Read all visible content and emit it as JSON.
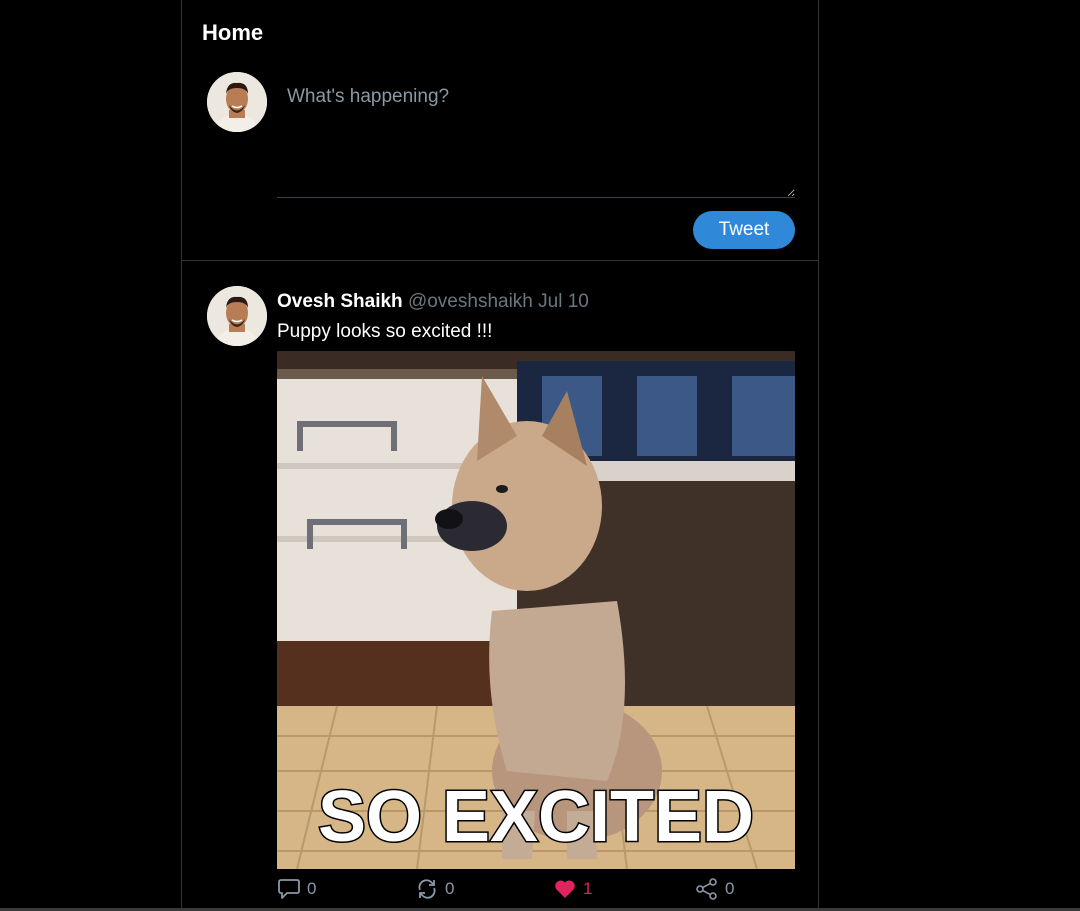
{
  "header": {
    "title": "Home"
  },
  "composer": {
    "placeholder": "What's happening?",
    "value": "",
    "tweet_label": "Tweet",
    "avatar_icon": "user-avatar"
  },
  "post": {
    "author_name": "Ovesh Shaikh",
    "author_handle": "@oveshshaikh",
    "date": "Jul 10",
    "text": "Puppy looks so excited !!!",
    "media_caption": "SO EXCITED",
    "avatar_icon": "user-avatar",
    "actions": {
      "reply": {
        "icon": "comment-icon",
        "count": "0"
      },
      "retweet": {
        "icon": "retweet-icon",
        "count": "0"
      },
      "like": {
        "icon": "heart-icon",
        "count": "1",
        "liked": true,
        "color": "#e0245e"
      },
      "share": {
        "icon": "share-icon",
        "count": "0"
      }
    }
  },
  "colors": {
    "background": "#000000",
    "accent": "#2f88d8",
    "border": "#2f3336",
    "muted_text": "#6e767d"
  }
}
